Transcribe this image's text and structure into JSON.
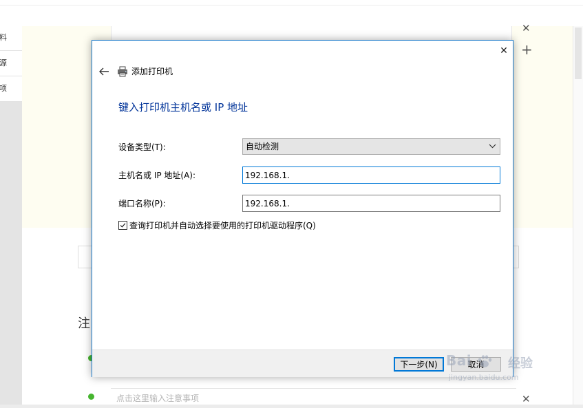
{
  "background": {
    "sidebar_items": [
      "料",
      "源",
      "项"
    ],
    "heading_partial": "注",
    "note_placeholder": "点击这里输入注意事项"
  },
  "dialog": {
    "title": "添加打印机",
    "heading": "键入打印机主机名或 IP 地址",
    "device_type_label": "设备类型(T):",
    "device_type_value": "自动检测",
    "hostname_label": "主机名或 IP 地址(A):",
    "hostname_value": "192.168.1.",
    "port_label": "端口名称(P):",
    "port_value": "192.168.1.",
    "query_checkbox_label": "查询打印机并自动选择要使用的打印机驱动程序(Q)",
    "query_checkbox_checked": true,
    "next_button": "下一步(N)",
    "cancel_button": "取消"
  },
  "watermark": {
    "brand": "Bai",
    "brand2": "经验",
    "url": "jingyan.baidu.com"
  },
  "colors": {
    "accent": "#0078d7",
    "heading": "#003399",
    "status_green": "#46b52f"
  }
}
